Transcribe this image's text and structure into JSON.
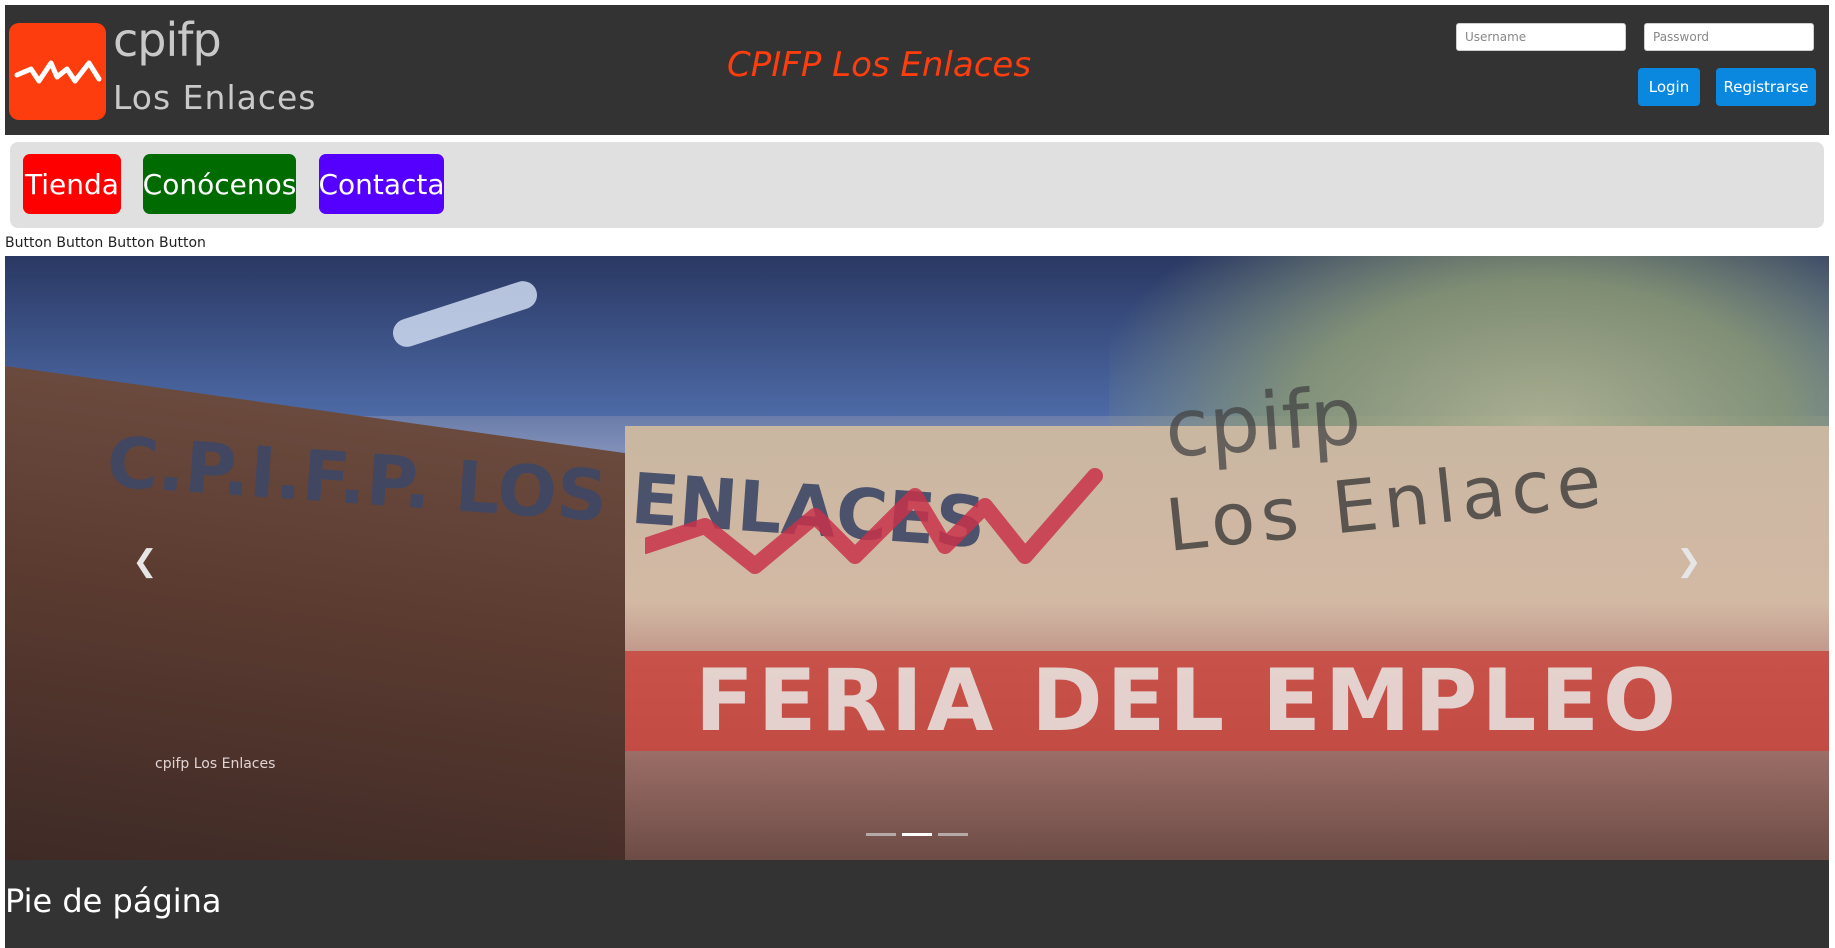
{
  "header": {
    "logo_top": "cpifp",
    "logo_bottom": "Los Enlaces",
    "title": "CPIFP Los Enlaces",
    "username_placeholder": "Username",
    "password_placeholder": "Password",
    "login_label": "Login",
    "register_label": "Registrarse"
  },
  "nav": {
    "items": [
      {
        "label": "Tienda",
        "color": "#ff0000"
      },
      {
        "label": "Conócenos",
        "color": "#006b00"
      },
      {
        "label": "Contacta",
        "color": "#5500ff"
      }
    ]
  },
  "button_row": "Button Button Button Button",
  "carousel": {
    "prev_icon": "chevron-left-icon",
    "next_icon": "chevron-right-icon",
    "slide_text": {
      "wall": "C.P.I.F.P. LOS ENLACES",
      "logo_top": "cpifp",
      "logo_bottom": "Los Enlace",
      "banner": "FERIA DEL EMPLEO",
      "small_sign": "cpifp Los Enlaces"
    },
    "indicator_count": 3,
    "active_indicator": 1
  },
  "footer": {
    "text": "Pie de página"
  },
  "colors": {
    "header_bg": "#333333",
    "accent": "#fe3d0e",
    "button_blue": "#0a88e0",
    "nav_bg": "#e0e0e0"
  }
}
